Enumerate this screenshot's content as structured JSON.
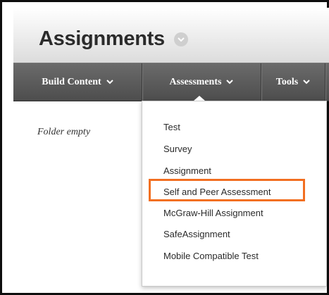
{
  "header": {
    "title": "Assignments"
  },
  "nav": {
    "items": [
      {
        "label": "Build Content",
        "icon": "chevron-down-icon"
      },
      {
        "label": "Assessments",
        "icon": "chevron-down-icon"
      },
      {
        "label": "Tools",
        "icon": "chevron-down-icon"
      }
    ]
  },
  "content": {
    "empty_message": "Folder empty"
  },
  "assessments_menu": {
    "items": [
      {
        "label": "Test"
      },
      {
        "label": "Survey"
      },
      {
        "label": "Assignment"
      },
      {
        "label": "Self and Peer Assessment",
        "highlighted": true
      },
      {
        "label": "McGraw-Hill Assignment"
      },
      {
        "label": "SafeAssignment"
      },
      {
        "label": "Mobile Compatible Test"
      }
    ]
  },
  "colors": {
    "highlight": "#f26f21",
    "nav_background": "#5a5a5a",
    "title_text": "#2b2b2b"
  }
}
